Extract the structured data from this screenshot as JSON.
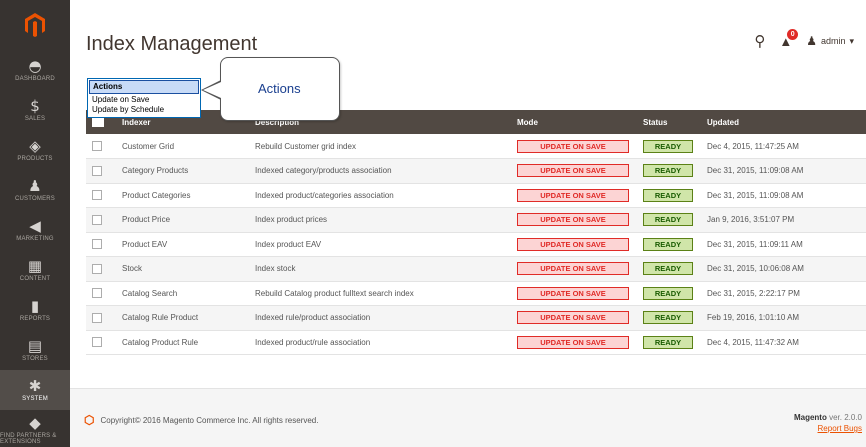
{
  "sidebar": {
    "logo_icon": "magento-logo-icon",
    "items": [
      {
        "label": "DASHBOARD",
        "icon": "dashboard-icon",
        "glyph": "◓"
      },
      {
        "label": "SALES",
        "icon": "dollar-icon",
        "glyph": "$"
      },
      {
        "label": "PRODUCTS",
        "icon": "cube-icon",
        "glyph": "◈"
      },
      {
        "label": "CUSTOMERS",
        "icon": "person-icon",
        "glyph": "♟"
      },
      {
        "label": "MARKETING",
        "icon": "megaphone-icon",
        "glyph": "◀"
      },
      {
        "label": "CONTENT",
        "icon": "layout-icon",
        "glyph": "▦"
      },
      {
        "label": "REPORTS",
        "icon": "bar-chart-icon",
        "glyph": "▮"
      },
      {
        "label": "STORES",
        "icon": "store-icon",
        "glyph": "▤"
      },
      {
        "label": "SYSTEM",
        "icon": "gear-icon",
        "glyph": "✱"
      },
      {
        "label": "FIND PARTNERS & EXTENSIONS",
        "icon": "partners-icon",
        "glyph": "◆"
      }
    ]
  },
  "header": {
    "title": "Index Management",
    "user_name": "admin",
    "notification_count": "0"
  },
  "actions": {
    "selected": "Actions",
    "options": [
      "Update on Save",
      "Update by Schedule"
    ]
  },
  "callout": {
    "text": "Actions"
  },
  "table": {
    "columns": {
      "indexer": "Indexer",
      "description": "Description",
      "mode": "Mode",
      "status": "Status",
      "updated": "Updated"
    },
    "rows": [
      {
        "indexer": "Customer Grid",
        "description": "Rebuild Customer grid index",
        "mode": "UPDATE ON SAVE",
        "status": "READY",
        "updated": "Dec 4, 2015, 11:47:25 AM"
      },
      {
        "indexer": "Category Products",
        "description": "Indexed category/products association",
        "mode": "UPDATE ON SAVE",
        "status": "READY",
        "updated": "Dec 31, 2015, 11:09:08 AM"
      },
      {
        "indexer": "Product Categories",
        "description": "Indexed product/categories association",
        "mode": "UPDATE ON SAVE",
        "status": "READY",
        "updated": "Dec 31, 2015, 11:09:08 AM"
      },
      {
        "indexer": "Product Price",
        "description": "Index product prices",
        "mode": "UPDATE ON SAVE",
        "status": "READY",
        "updated": "Jan 9, 2016, 3:51:07 PM"
      },
      {
        "indexer": "Product EAV",
        "description": "Index product EAV",
        "mode": "UPDATE ON SAVE",
        "status": "READY",
        "updated": "Dec 31, 2015, 11:09:11 AM"
      },
      {
        "indexer": "Stock",
        "description": "Index stock",
        "mode": "UPDATE ON SAVE",
        "status": "READY",
        "updated": "Dec 31, 2015, 10:06:08 AM"
      },
      {
        "indexer": "Catalog Search",
        "description": "Rebuild Catalog product fulltext search index",
        "mode": "UPDATE ON SAVE",
        "status": "READY",
        "updated": "Dec 31, 2015, 2:22:17 PM"
      },
      {
        "indexer": "Catalog Rule Product",
        "description": "Indexed rule/product association",
        "mode": "UPDATE ON SAVE",
        "status": "READY",
        "updated": "Feb 19, 2016, 1:01:10 AM"
      },
      {
        "indexer": "Catalog Product Rule",
        "description": "Indexed product/rule association",
        "mode": "UPDATE ON SAVE",
        "status": "READY",
        "updated": "Dec 4, 2015, 11:47:32 AM"
      }
    ]
  },
  "footer": {
    "copyright": "Copyright© 2016 Magento Commerce Inc. All rights reserved.",
    "brand": "Magento",
    "version": "ver. 2.0.0",
    "report_bugs": "Report Bugs"
  },
  "colors": {
    "sidebar": "#373330",
    "accent": "#eb5202",
    "table_header": "#514943",
    "mode_red": "#e02b27",
    "status_green": "#185b00"
  }
}
